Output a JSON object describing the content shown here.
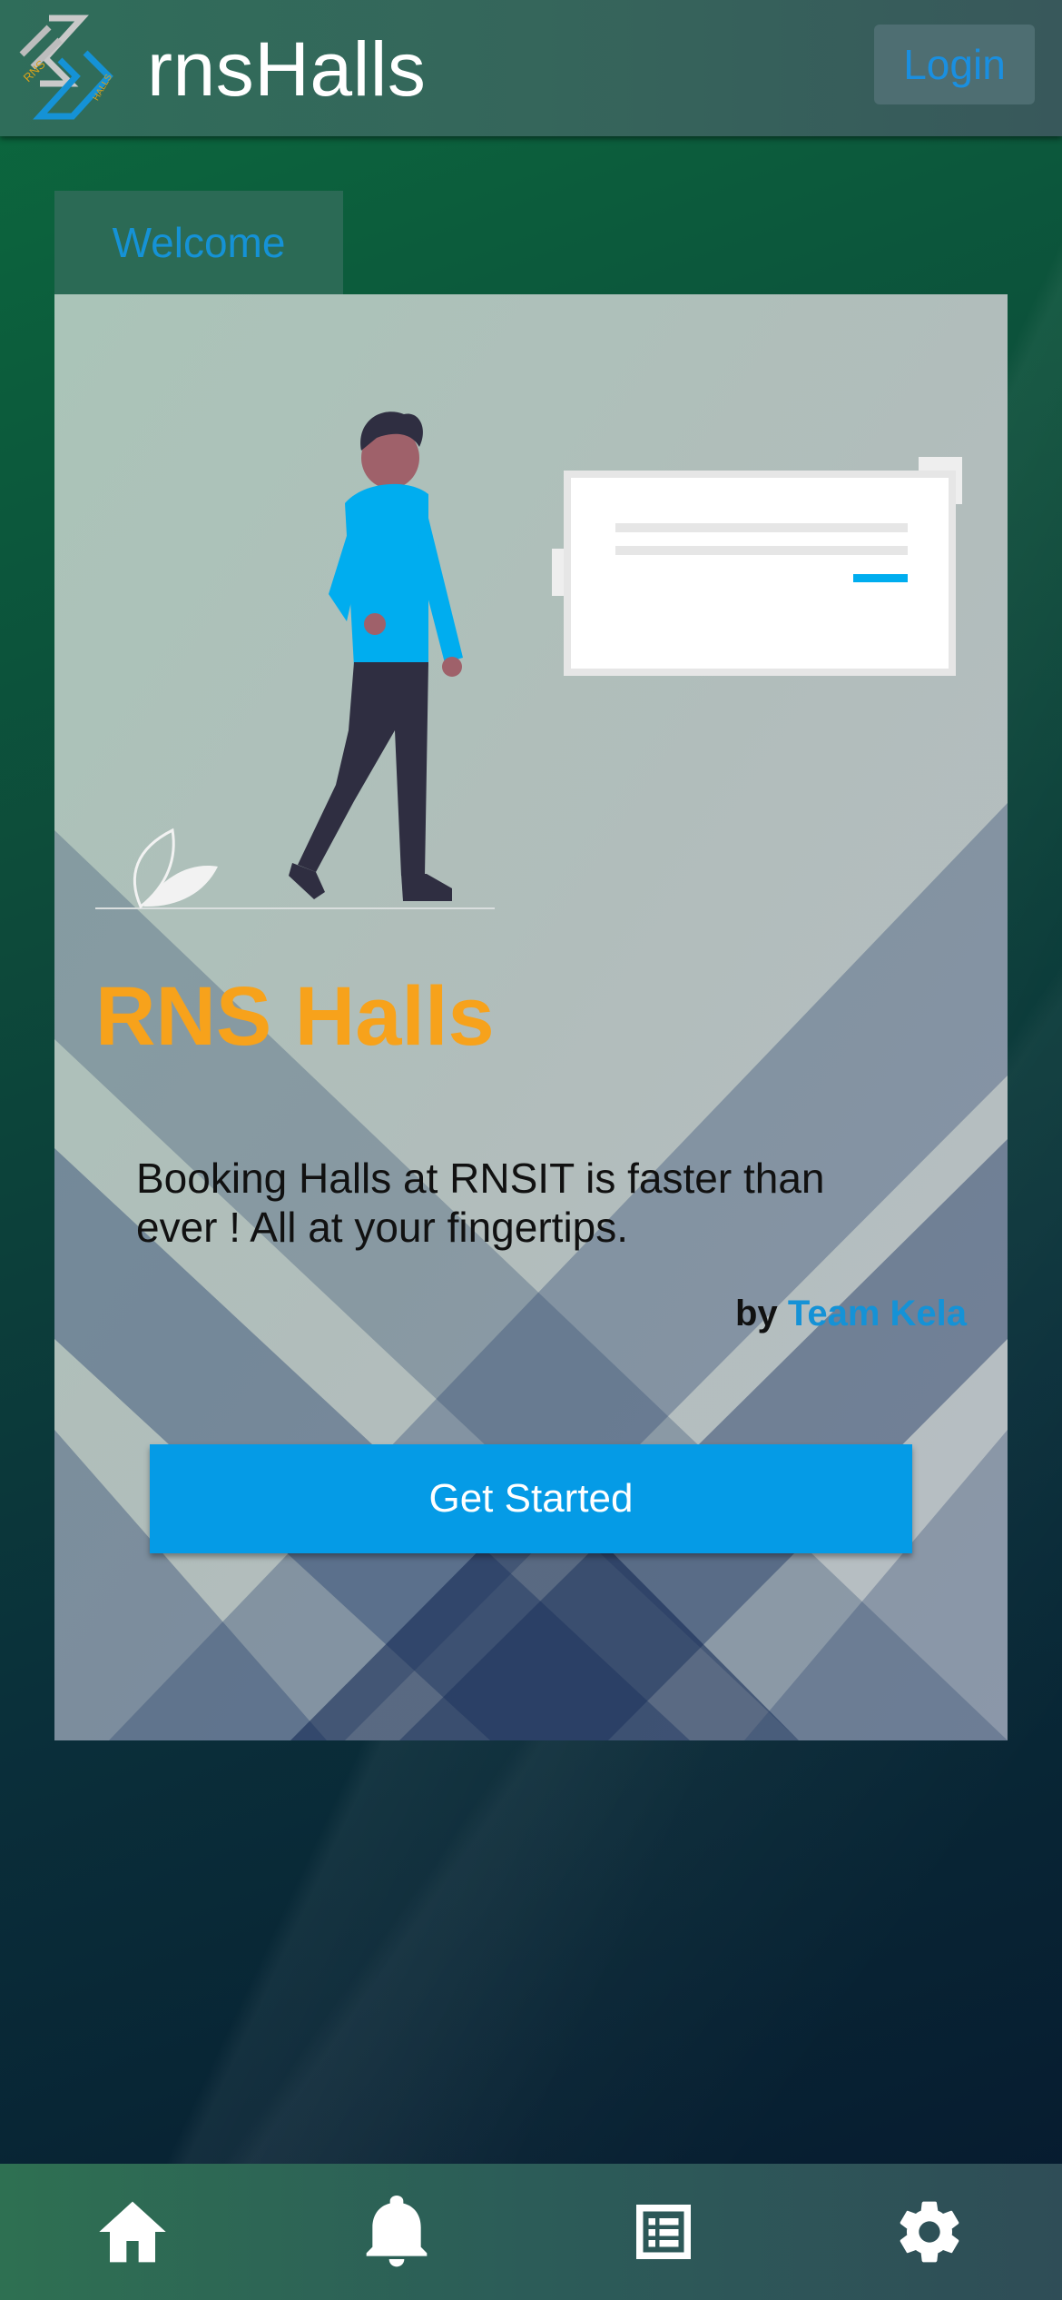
{
  "header": {
    "app_title": "rnsHalls",
    "login_label": "Login",
    "logo_letters_left": "RNS",
    "logo_letters_right": "HALLS"
  },
  "tabs": {
    "welcome_label": "Welcome"
  },
  "card": {
    "title": "RNS Halls",
    "description": "Booking Halls at RNSIT is faster than ever ! All at your fingertips.",
    "by_label": "by",
    "team_name": "Team Kela",
    "cta_label": "Get Started"
  },
  "bottom_nav": {
    "items": [
      {
        "icon": "home-icon"
      },
      {
        "icon": "bell-icon"
      },
      {
        "icon": "list-icon"
      },
      {
        "icon": "gear-icon"
      }
    ]
  },
  "colors": {
    "accent_blue": "#059be6",
    "title_orange": "#f7a21b",
    "link_blue": "#1592d6"
  }
}
